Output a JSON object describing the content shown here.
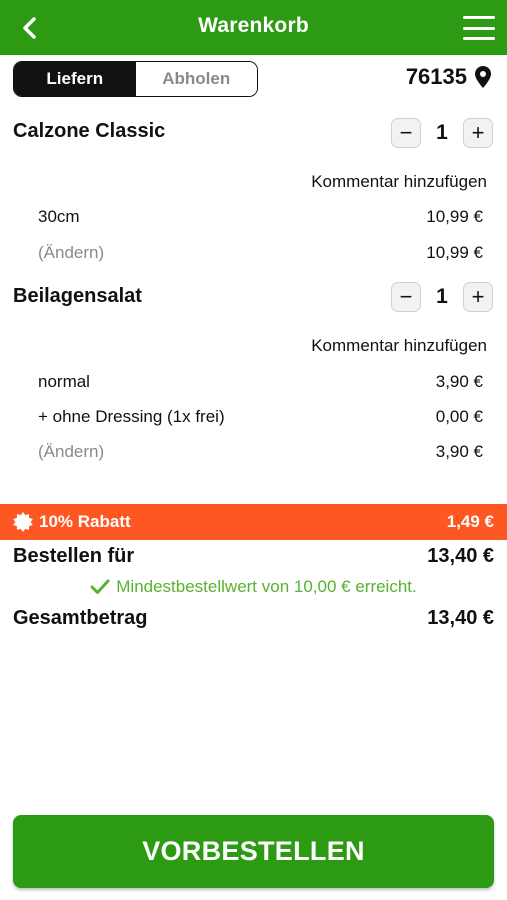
{
  "header": {
    "title": "Warenkorb",
    "back_icon": "chevron-left-icon",
    "menu_icon": "hamburger-menu-icon",
    "color": "#2c9a13"
  },
  "delivery_toggle": {
    "options": [
      "Liefern",
      "Abholen"
    ],
    "selected": "Liefern"
  },
  "location": {
    "zip": "76135",
    "icon": "location-pin-icon"
  },
  "cart": {
    "items": [
      {
        "name": "Calzone Classic",
        "quantity": "1",
        "comment_label": "Kommentar hinzufügen",
        "lines": [
          {
            "label": "30cm",
            "price": "10,99 €"
          },
          {
            "label": "(Ändern)",
            "price": "10,99 €"
          }
        ]
      },
      {
        "name": "Beilagensalat",
        "quantity": "1",
        "comment_label": "Kommentar hinzufügen",
        "lines": [
          {
            "label": "normal",
            "price": "3,90 €"
          },
          {
            "label": "+ ohne Dressing (1x frei)",
            "price": "0,00 €"
          },
          {
            "label": "(Ändern)",
            "price": "3,90 €"
          }
        ]
      }
    ]
  },
  "discount": {
    "label": "10% Rabatt",
    "amount": "1,49 €",
    "icon": "badge-icon",
    "color": "#fd5722"
  },
  "order_for": {
    "label": "Bestellen für",
    "amount": "13,40 €"
  },
  "min_order": {
    "text": "Mindestbestellwert von 10,00 € erreicht.",
    "icon": "checkmark-icon",
    "color": "#58b231"
  },
  "total": {
    "label": "Gesamtbetrag",
    "amount": "13,40 €"
  },
  "cta": {
    "label": "VORBESTELLEN"
  }
}
